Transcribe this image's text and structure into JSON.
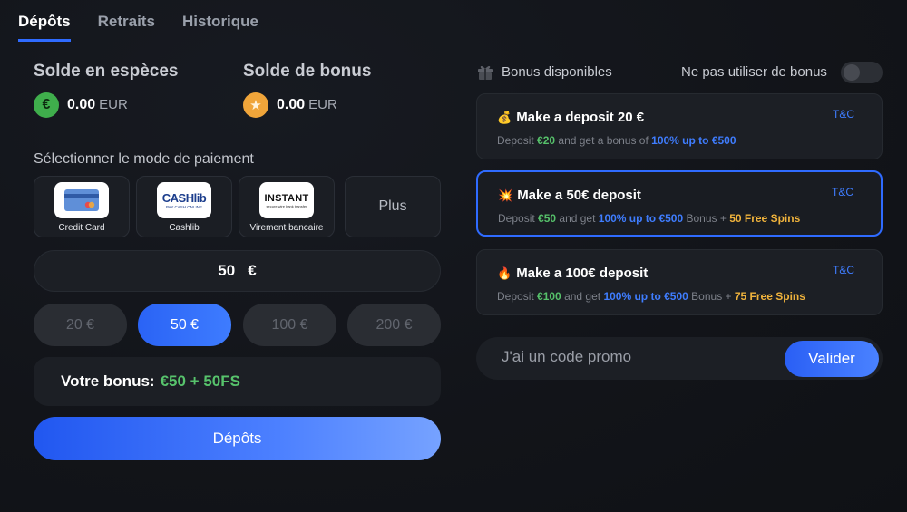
{
  "tabs": [
    "Dépôts",
    "Retraits",
    "Historique"
  ],
  "cash": {
    "title": "Solde en espèces",
    "icon": "euro-coin-icon",
    "icon_glyph": "€",
    "amount": "0.00",
    "currency": "EUR"
  },
  "bonus_balance": {
    "title": "Solde de bonus",
    "icon": "star-coin-icon",
    "icon_glyph": "★",
    "amount": "0.00",
    "currency": "EUR"
  },
  "payment": {
    "label": "Sélectionner le mode de paiement",
    "methods": [
      {
        "label": "Credit Card"
      },
      {
        "label": "Cashlib",
        "logo_text": "CASHlib",
        "logo_sub": "PAY CASH ONLINE"
      },
      {
        "label": "Virement bancaire",
        "logo_text": "INSTANT",
        "logo_sub": "secure wire bank transfer"
      }
    ],
    "more": "Plus"
  },
  "amount_input": {
    "value": "50",
    "currency": "€"
  },
  "quick_amounts": [
    "20 €",
    "50 €",
    "100 €",
    "200 €"
  ],
  "bonus_summary": {
    "label": "Votre bonus:",
    "value": "€50 + 50FS"
  },
  "deposit_button": "Dépôts",
  "bonuses": {
    "title": "Bonus disponibles",
    "no_bonus_label": "Ne pas utiliser de bonus",
    "offers": [
      {
        "emoji": "💰",
        "title": "Make a deposit 20 €",
        "tc": "T&C",
        "desc": {
          "p1": "Deposit ",
          "amount": "€20",
          "p2": " and get a bonus of ",
          "bonus": "100% up to €500"
        }
      },
      {
        "emoji": "💥",
        "title": "Make a 50€ deposit",
        "tc": "T&C",
        "desc": {
          "p1": "Deposit ",
          "amount": "€50",
          "p2": " and get ",
          "bonus": "100% up to €500",
          "p3": " Bonus + ",
          "spins": "50 Free Spins"
        }
      },
      {
        "emoji": "🔥",
        "title": "Make a 100€ deposit",
        "tc": "T&C",
        "desc": {
          "p1": "Deposit ",
          "amount": "€100",
          "p2": " and get ",
          "bonus": "100% up to €500",
          "p3": " Bonus + ",
          "spins": "75 Free Spins"
        }
      }
    ]
  },
  "promo": {
    "placeholder": "J'ai un code promo",
    "button": "Valider"
  },
  "colors": {
    "accent": "#2f6bff",
    "green": "#56c16a",
    "gold": "#f0b33c"
  }
}
